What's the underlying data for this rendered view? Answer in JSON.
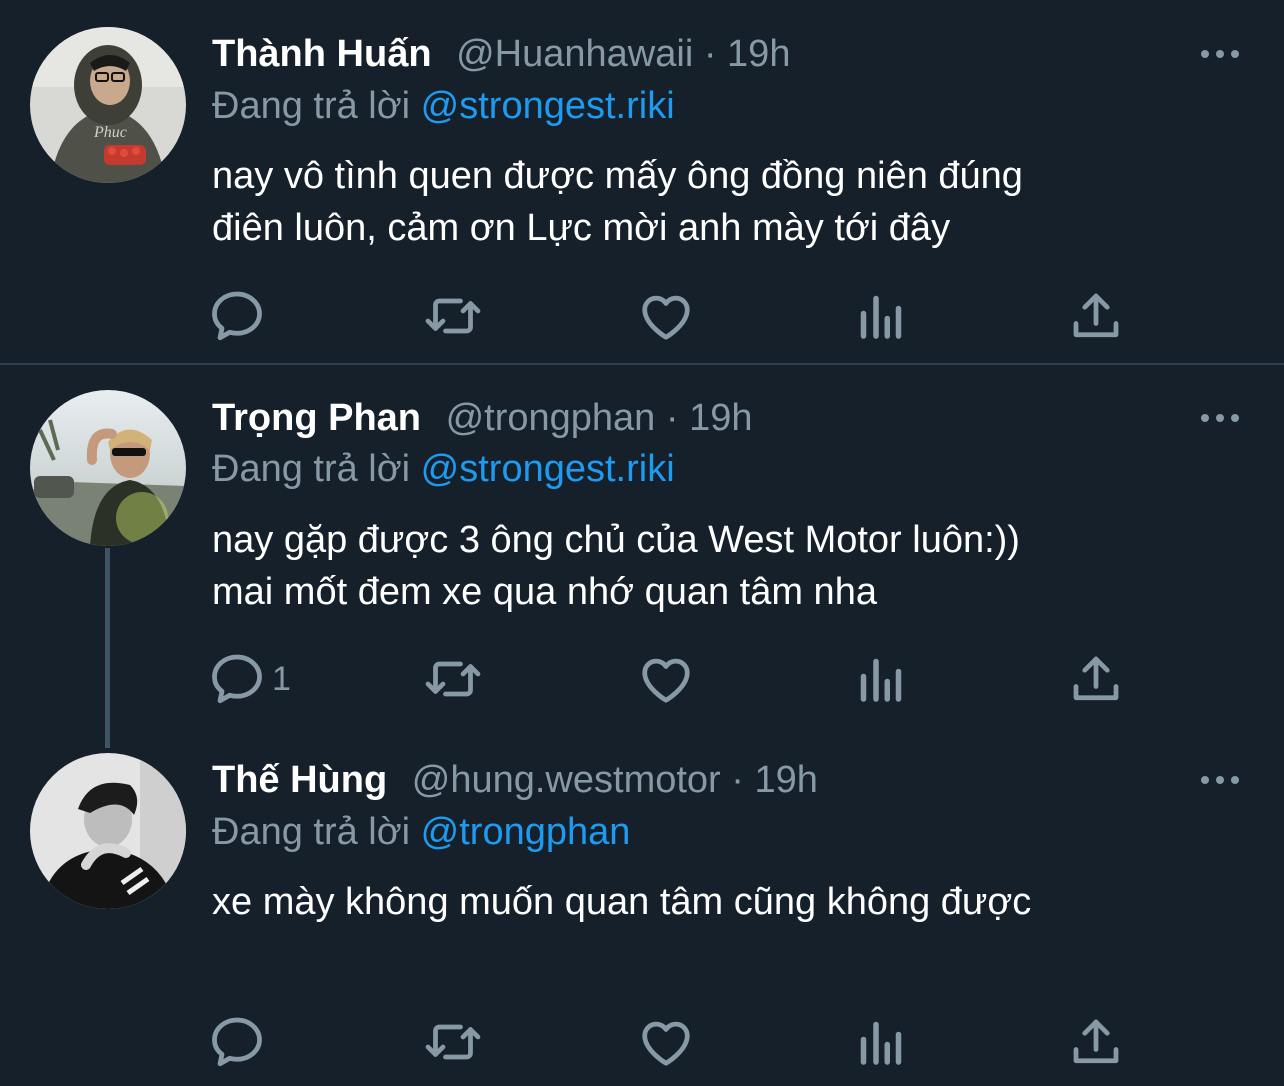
{
  "tweets": [
    {
      "name": "Thành Huấn",
      "handle": "@Huanhawaii",
      "separator": "·",
      "time": "19h",
      "reply_label": "Đang trả lời",
      "reply_to": "@strongest.riki",
      "text_lines": [
        "nay vô tình quen được mấy ông đồng niên đúng",
        "điên luôn, cảm ơn Lực mời anh mày tới đây"
      ],
      "reply_count": ""
    },
    {
      "name": "Trọng Phan",
      "handle": "@trongphan",
      "separator": "·",
      "time": "19h",
      "reply_label": "Đang trả lời",
      "reply_to": "@strongest.riki",
      "text_lines": [
        "nay gặp được 3 ông chủ của West Motor luôn:))",
        "mai mốt đem xe qua nhớ quan tâm nha"
      ],
      "reply_count": "1"
    },
    {
      "name": "Thế Hùng",
      "handle": "@hung.westmotor",
      "separator": "·",
      "time": "19h",
      "reply_label": "Đang trả lời",
      "reply_to": "@trongphan",
      "text_lines": [
        "xe mày không muốn quan tâm cũng không được"
      ],
      "reply_count": ""
    }
  ],
  "icons": {
    "more": "more-horizontal-icon",
    "reply": "reply-icon",
    "retweet": "retweet-icon",
    "like": "like-icon",
    "analytics": "analytics-icon",
    "share": "share-icon"
  },
  "colors": {
    "background": "#15202b",
    "text": "#ffffff",
    "secondary": "#8899a6",
    "accent": "#1d9bf0"
  }
}
